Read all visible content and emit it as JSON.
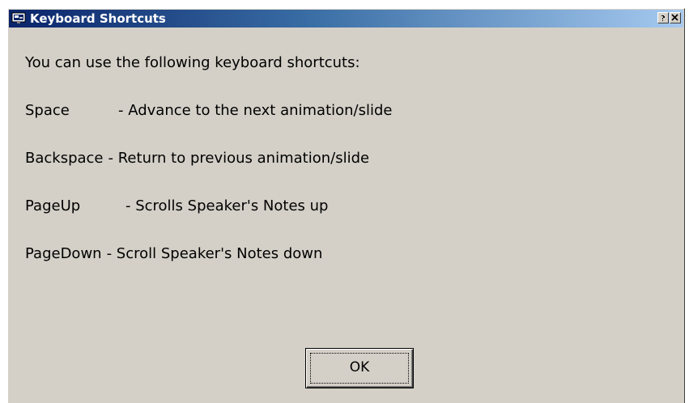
{
  "window": {
    "title": "Keyboard Shortcuts",
    "icon": "presentation-icon",
    "caption_buttons": [
      "help-icon",
      "close-icon"
    ]
  },
  "intro": "You can use the following keyboard shortcuts:",
  "shortcuts": [
    {
      "key": "Space",
      "description": "- Advance to the next animation/slide"
    },
    {
      "key": "Backspace",
      "description": "- Return to previous animation/slide"
    },
    {
      "key": "PageUp",
      "description": "- Scrolls Speaker's Notes up"
    },
    {
      "key": "PageDown",
      "description": "- Scroll Speaker's Notes down"
    }
  ],
  "buttons": {
    "ok_label": "OK"
  },
  "colors": {
    "dialog_background": "#d4d0c8",
    "titlebar_start": "#0a246a",
    "titlebar_end": "#a6caf0",
    "title_text": "#ffffff"
  }
}
